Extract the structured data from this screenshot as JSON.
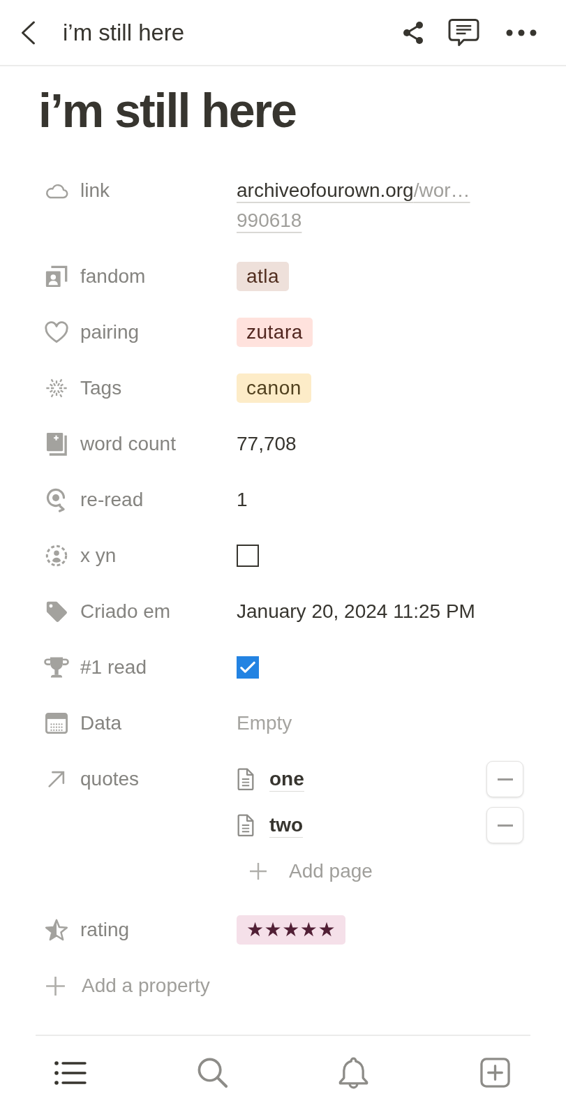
{
  "top_bar": {
    "title": "i’m still here"
  },
  "page": {
    "title": "i’m still here"
  },
  "properties": [
    {
      "kind": "link",
      "label": "link",
      "domain": "archiveofourown.org",
      "path": "/wor…",
      "tail": "990618"
    },
    {
      "kind": "tag",
      "label": "fandom",
      "value": "atla",
      "color": "#eee0da"
    },
    {
      "kind": "tag",
      "label": "pairing",
      "value": "zutara",
      "color": "#ffe2dd"
    },
    {
      "kind": "tag",
      "label": "Tags",
      "value": "canon",
      "color": "#fdecc8"
    },
    {
      "kind": "number",
      "label": "word count",
      "value": "77,708"
    },
    {
      "kind": "number",
      "label": "re-read",
      "value": "1"
    },
    {
      "kind": "checkbox",
      "label": "x yn",
      "checked": false
    },
    {
      "kind": "date",
      "label": "Criado em",
      "value": "January 20, 2024 11:25 PM"
    },
    {
      "kind": "checkbox",
      "label": "#1 read",
      "checked": true
    },
    {
      "kind": "empty",
      "label": "Data",
      "placeholder": "Empty"
    },
    {
      "kind": "relation",
      "label": "quotes",
      "pages": [
        {
          "title": "one"
        },
        {
          "title": "two"
        }
      ],
      "add_label": "Add page"
    },
    {
      "kind": "tag",
      "label": "rating",
      "value": "★★★★★",
      "color": "#f5e0e9"
    }
  ],
  "add_property": "Add a property"
}
